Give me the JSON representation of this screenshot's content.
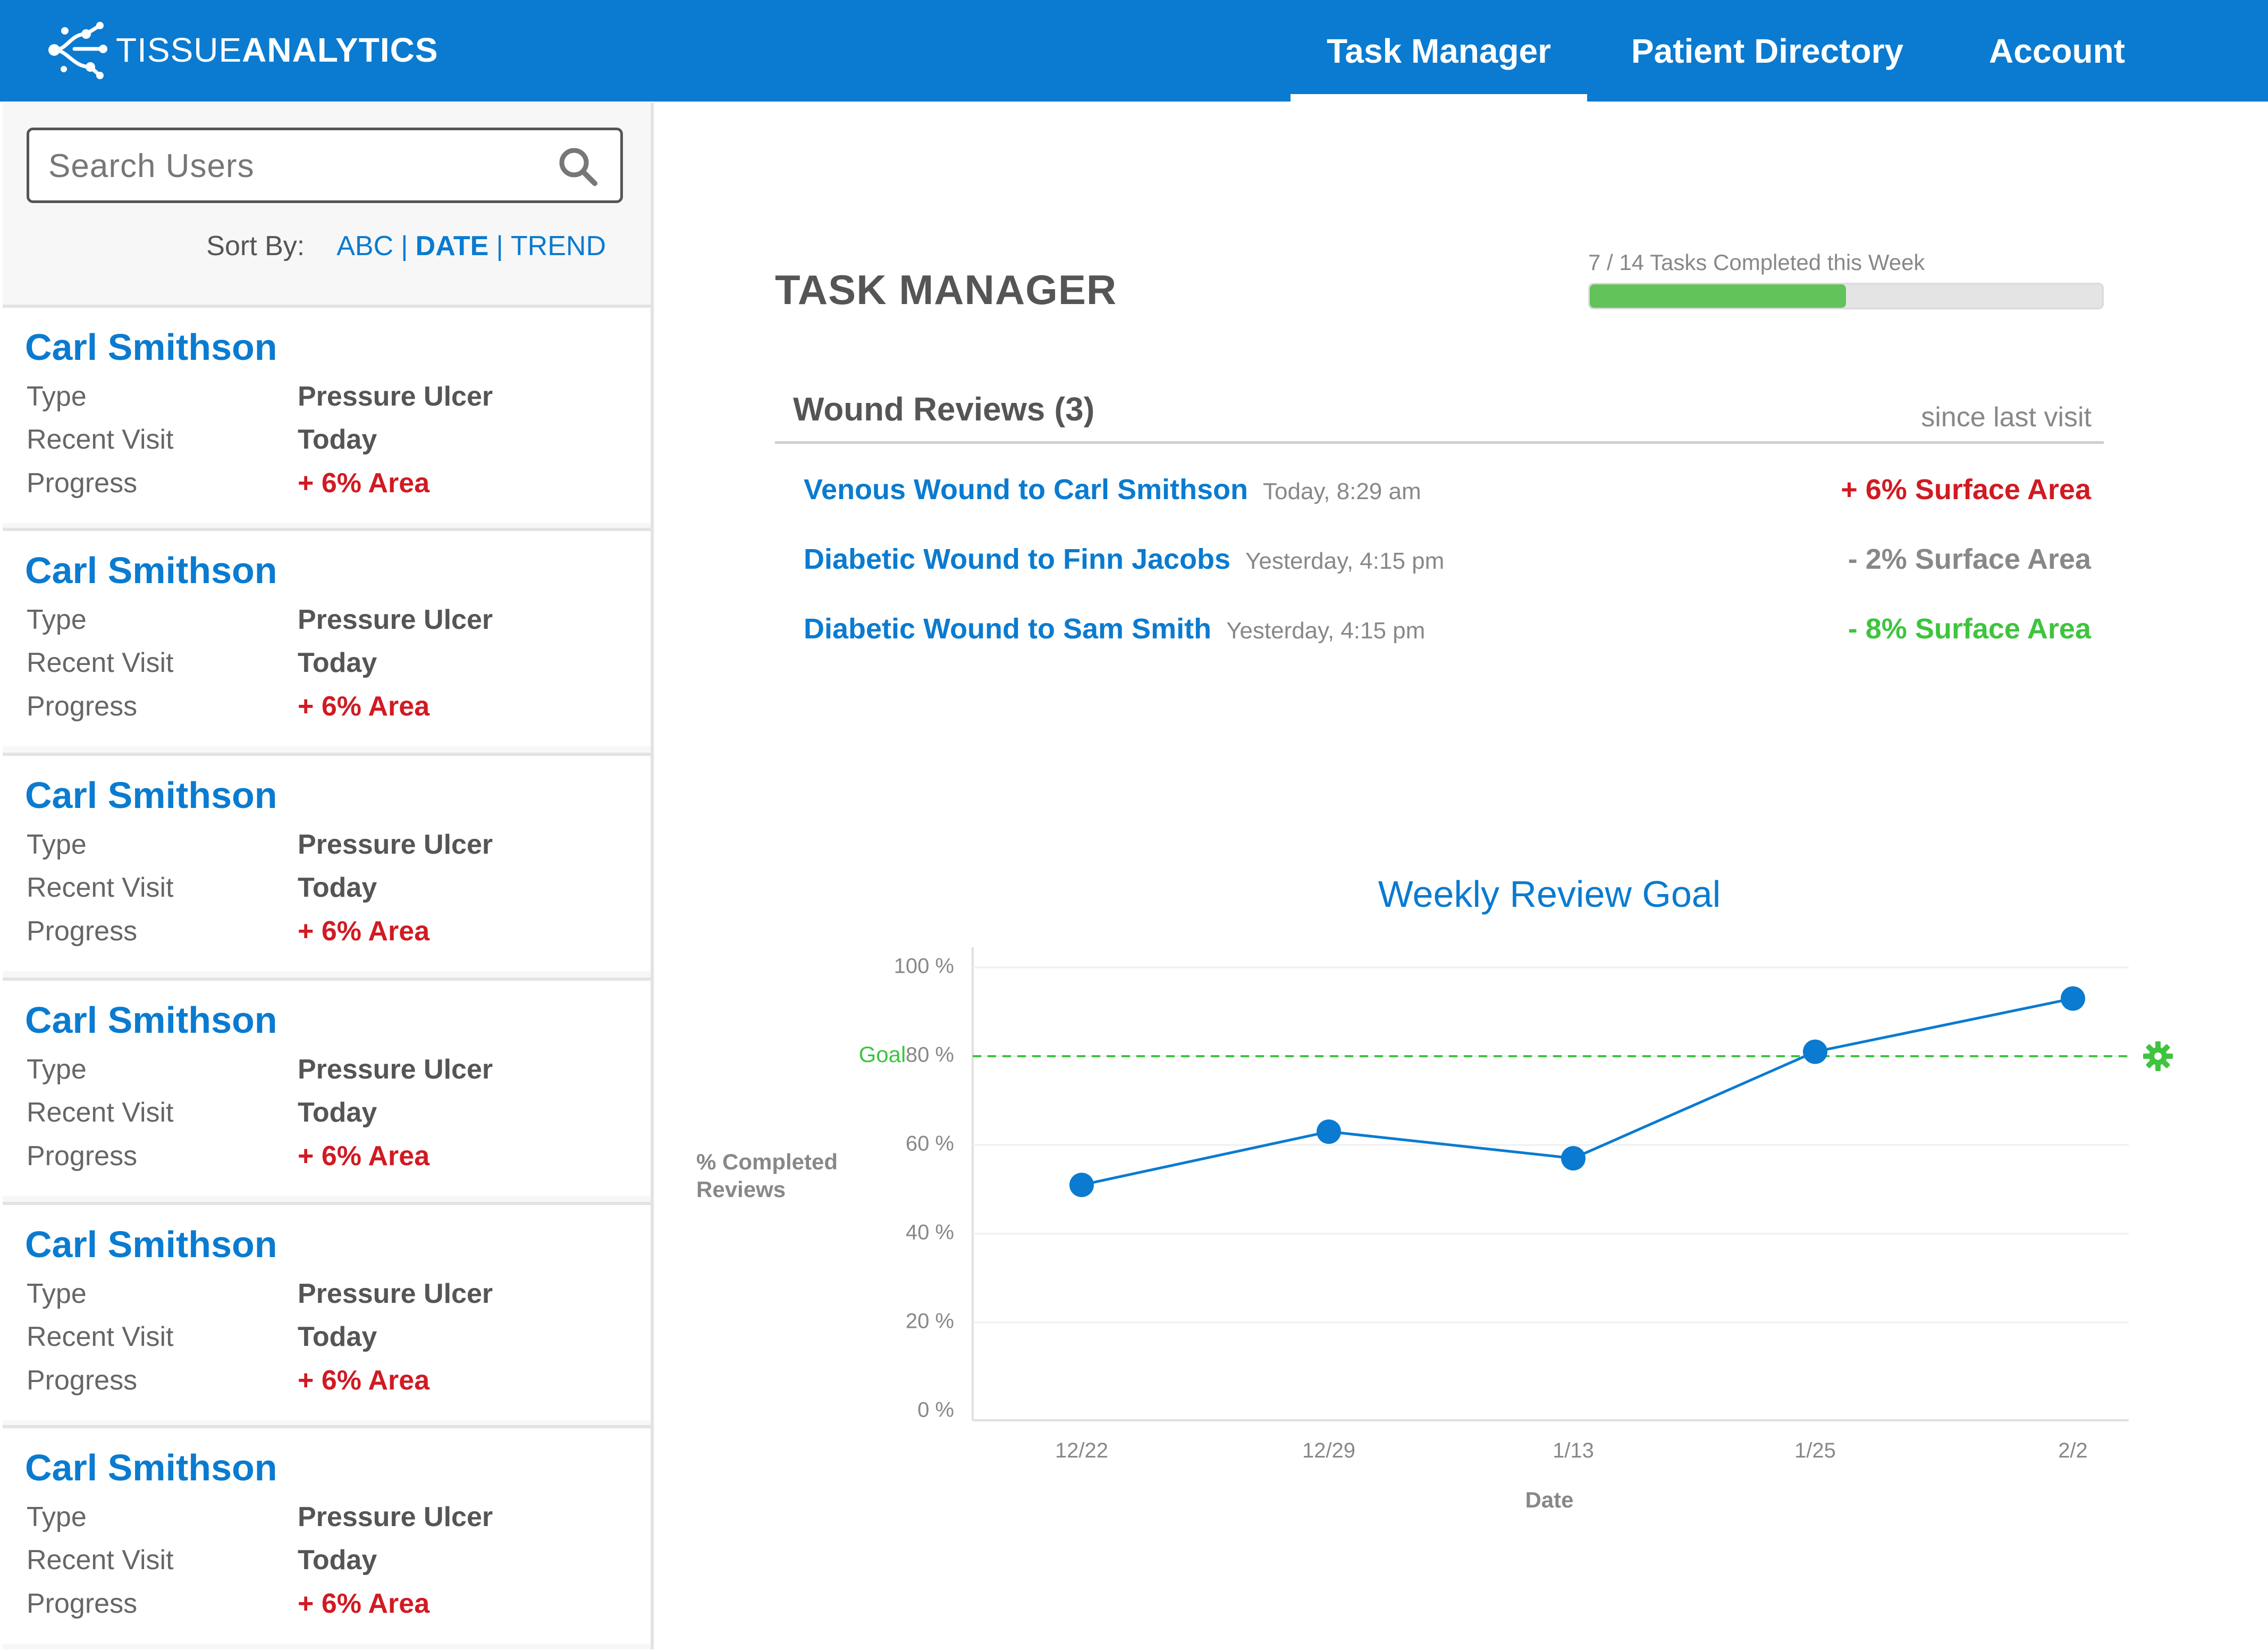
{
  "brand": {
    "name_light": "TISSUE",
    "name_bold": "ANALYTICS"
  },
  "nav": [
    {
      "label": "Task Manager",
      "active": true
    },
    {
      "label": "Patient Directory",
      "active": false
    },
    {
      "label": "Account",
      "active": false
    }
  ],
  "sidebar": {
    "search_placeholder": "Search Users",
    "sort_label": "Sort By:",
    "sort_options": [
      "ABC",
      "DATE",
      "TREND"
    ],
    "sort_active": "DATE",
    "patients": [
      {
        "name": "Carl Smithson",
        "type_label": "Type",
        "type": "Pressure Ulcer",
        "visit_label": "Recent Visit",
        "visit": "Today",
        "progress_label": "Progress",
        "progress": "+ 6% Area"
      },
      {
        "name": "Carl Smithson",
        "type_label": "Type",
        "type": "Pressure Ulcer",
        "visit_label": "Recent Visit",
        "visit": "Today",
        "progress_label": "Progress",
        "progress": "+ 6% Area"
      },
      {
        "name": "Carl Smithson",
        "type_label": "Type",
        "type": "Pressure Ulcer",
        "visit_label": "Recent Visit",
        "visit": "Today",
        "progress_label": "Progress",
        "progress": "+ 6% Area"
      },
      {
        "name": "Carl Smithson",
        "type_label": "Type",
        "type": "Pressure Ulcer",
        "visit_label": "Recent Visit",
        "visit": "Today",
        "progress_label": "Progress",
        "progress": "+ 6% Area"
      },
      {
        "name": "Carl Smithson",
        "type_label": "Type",
        "type": "Pressure Ulcer",
        "visit_label": "Recent Visit",
        "visit": "Today",
        "progress_label": "Progress",
        "progress": "+ 6% Area"
      },
      {
        "name": "Carl Smithson",
        "type_label": "Type",
        "type": "Pressure Ulcer",
        "visit_label": "Recent Visit",
        "visit": "Today",
        "progress_label": "Progress",
        "progress": "+ 6% Area"
      }
    ]
  },
  "main": {
    "title": "TASK MANAGER",
    "tasks": {
      "label": "7 / 14 Tasks Completed this Week",
      "completed": 7,
      "total": 14
    },
    "reviews": {
      "title": "Wound Reviews (3)",
      "subtitle": "since last visit",
      "items": [
        {
          "title": "Venous Wound to Carl Smithson",
          "date": "Today, 8:29 am",
          "change": "+ 6% Surface Area",
          "status": "red"
        },
        {
          "title": "Diabetic Wound to Finn Jacobs",
          "date": "Yesterday, 4:15 pm",
          "change": "- 2% Surface Area",
          "status": "gray"
        },
        {
          "title": "Diabetic Wound to Sam Smith",
          "date": "Yesterday, 4:15 pm",
          "change": "- 8% Surface Area",
          "status": "green"
        }
      ]
    }
  },
  "chart_data": {
    "type": "line",
    "title": "Weekly Review Goal",
    "xlabel": "Date",
    "ylabel": "% Completed Reviews",
    "categories": [
      "12/22",
      "12/29",
      "1/13",
      "1/25",
      "2/2"
    ],
    "values": [
      51,
      63,
      57,
      81,
      93
    ],
    "ylim": [
      0,
      100
    ],
    "yticks": [
      "0 %",
      "20 %",
      "40 %",
      "60 %",
      "80 %",
      "100 %"
    ],
    "goal": {
      "label": "Goal",
      "value": 80
    },
    "grid": true,
    "colors": {
      "line": "#0a7bd0",
      "goal": "#3ec43e"
    }
  },
  "colors": {
    "brand": "#0a7bd0",
    "alert": "#d11a22",
    "success": "#3ec43e",
    "progress": "#62c35a"
  }
}
